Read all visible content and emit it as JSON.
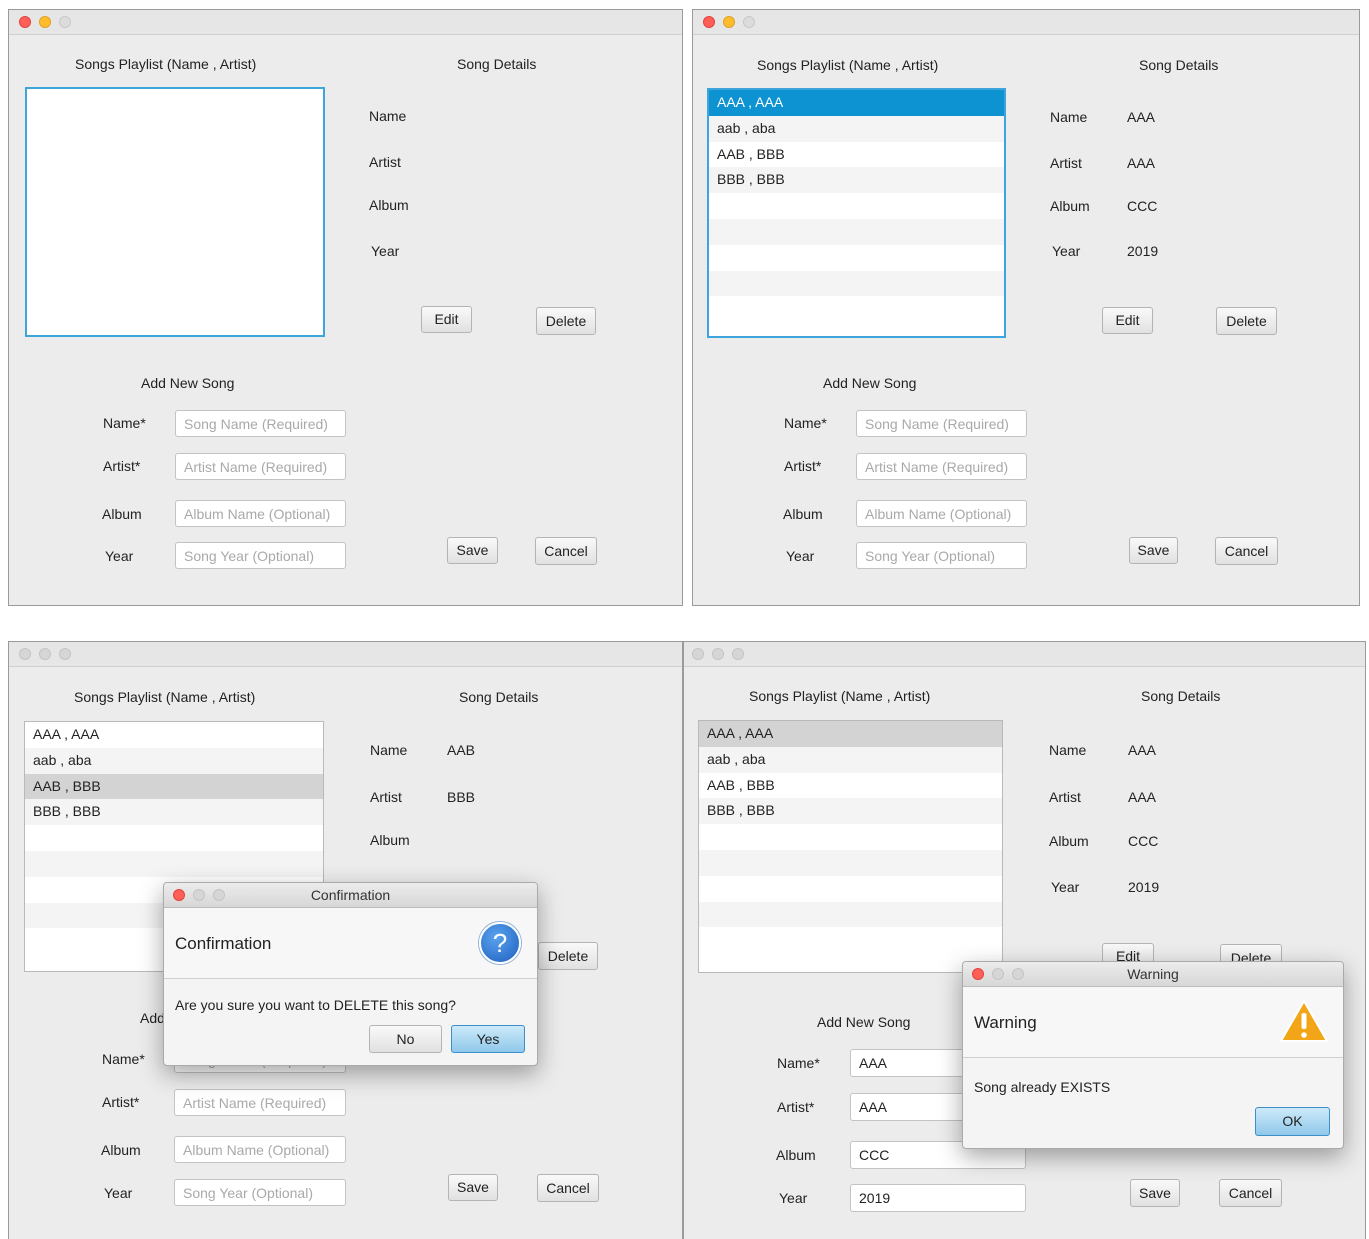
{
  "labels": {
    "playlist_heading": "Songs Playlist (Name , Artist)",
    "details_heading": "Song Details",
    "name": "Name",
    "artist": "Artist",
    "album": "Album",
    "year": "Year",
    "add_heading": "Add New Song",
    "name_req": "Name*",
    "artist_req": "Artist*",
    "album_opt": "Album",
    "year_opt": "Year"
  },
  "buttons": {
    "edit": "Edit",
    "delete": "Delete",
    "save": "Save",
    "cancel": "Cancel"
  },
  "placeholders": {
    "name": "Song Name (Required)",
    "artist": "Artist Name (Required)",
    "album": "Album Name (Optional)",
    "year": "Song Year (Optional)"
  },
  "songs": [
    "AAA , AAA",
    "aab , aba",
    "AAB , BBB",
    "BBB , BBB"
  ],
  "window2": {
    "details": {
      "name": "AAA",
      "artist": "AAA",
      "album": "CCC",
      "year": "2019"
    }
  },
  "window3": {
    "details": {
      "name": "AAB",
      "artist": "BBB"
    },
    "dialog": {
      "title": "Confirmation",
      "header": "Confirmation",
      "message": "Are you sure you want to DELETE this song?",
      "no": "No",
      "yes": "Yes"
    },
    "partial_add": "Add"
  },
  "window4": {
    "details": {
      "name": "AAA",
      "artist": "AAA",
      "album": "CCC",
      "year": "2019"
    },
    "inputs": {
      "name": "AAA",
      "artist": "AAA",
      "album": "CCC",
      "year": "2019"
    },
    "dialog": {
      "title": "Warning",
      "header": "Warning",
      "message": "Song already EXISTS",
      "ok": "OK"
    }
  },
  "colors": {
    "selection": "#0d92d2",
    "focus_border": "#3da5dc",
    "close": "#ff5f57",
    "minimize": "#ffbd2e",
    "warning": "#f2a516",
    "question": "#2a6fd0"
  },
  "icons": [
    "question-icon",
    "warning-icon"
  ]
}
